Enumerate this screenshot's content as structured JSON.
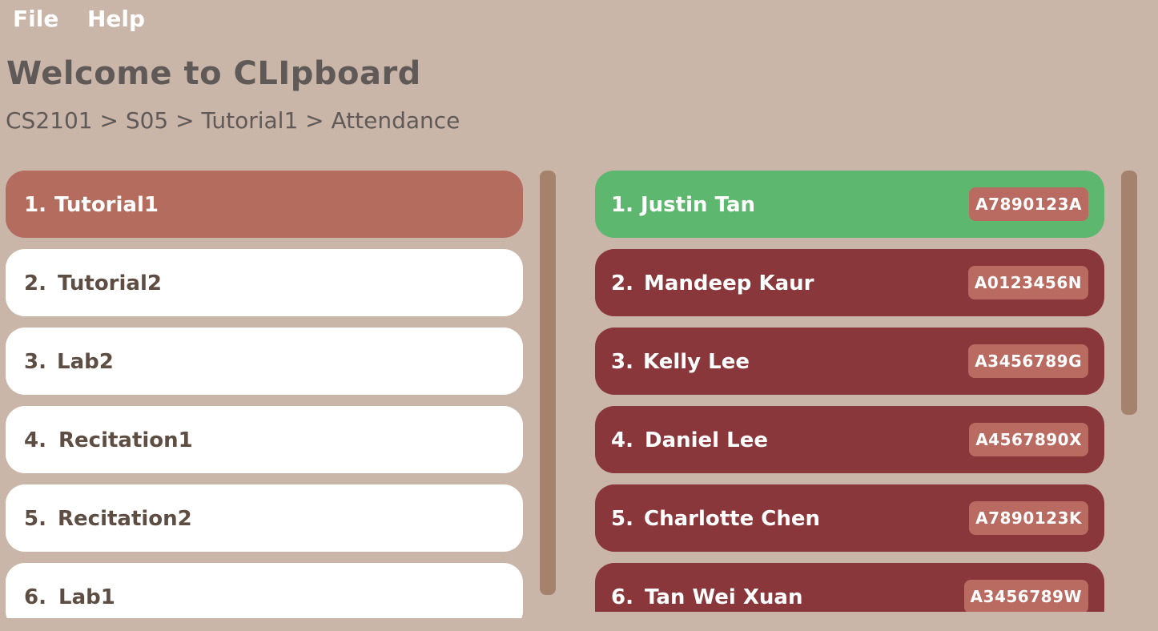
{
  "menu": {
    "file_label": "File",
    "help_label": "Help"
  },
  "header": {
    "title": "Welcome to CLIpboard",
    "breadcrumb": "CS2101 > S05 > Tutorial1 > Attendance"
  },
  "sessions": {
    "items": [
      {
        "index": "1.",
        "name": "Tutorial1",
        "selected": true
      },
      {
        "index": "2.",
        "name": "Tutorial2",
        "selected": false
      },
      {
        "index": "3.",
        "name": "Lab2",
        "selected": false
      },
      {
        "index": "4.",
        "name": "Recitation1",
        "selected": false
      },
      {
        "index": "5.",
        "name": "Recitation2",
        "selected": false
      },
      {
        "index": "6.",
        "name": "Lab1",
        "selected": false
      }
    ]
  },
  "students": {
    "items": [
      {
        "index": "1.",
        "name": "Justin Tan",
        "id": "A7890123A",
        "present": true
      },
      {
        "index": "2.",
        "name": "Mandeep Kaur",
        "id": "A0123456N",
        "present": false
      },
      {
        "index": "3.",
        "name": "Kelly Lee",
        "id": "A3456789G",
        "present": false
      },
      {
        "index": "4.",
        "name": "Daniel Lee",
        "id": "A4567890X",
        "present": false
      },
      {
        "index": "5.",
        "name": "Charlotte Chen",
        "id": "A7890123K",
        "present": false
      },
      {
        "index": "6.",
        "name": "Tan Wei Xuan",
        "id": "A3456789W",
        "present": false
      }
    ]
  },
  "colors": {
    "background": "#CAB5A9",
    "selected_session": "#B46C5F",
    "present": "#5EB76E",
    "absent": "#89373A",
    "badge": "#BA6B61",
    "scrollbar": "#A4826C"
  }
}
